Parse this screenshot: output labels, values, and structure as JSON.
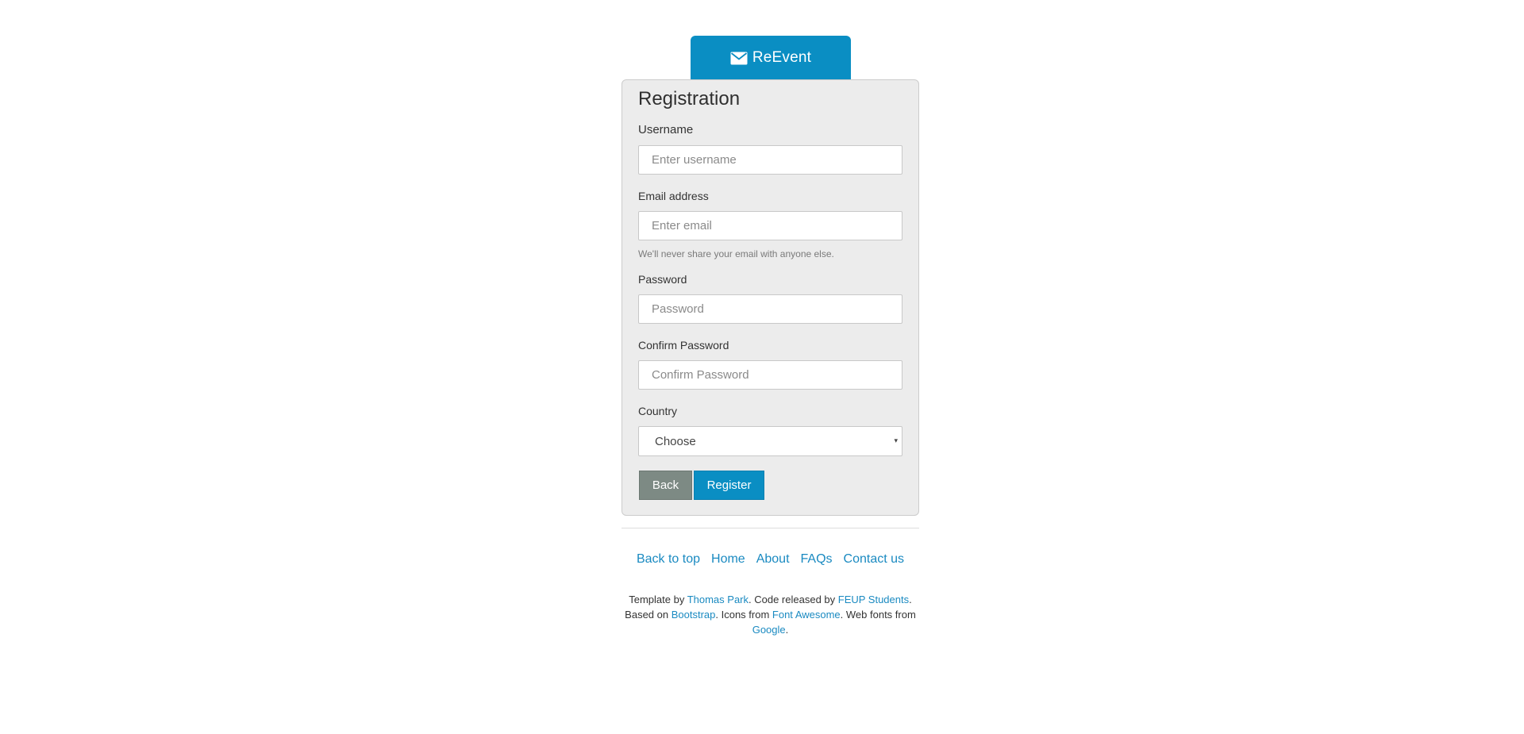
{
  "brand": {
    "name": "ReEvent",
    "icon": "envelope-icon",
    "color": "#0a8ec3"
  },
  "form": {
    "title": "Registration",
    "username": {
      "label": "Username",
      "placeholder": "Enter username"
    },
    "email": {
      "label": "Email address",
      "placeholder": "Enter email",
      "helper": "We'll never share your email with anyone else."
    },
    "password": {
      "label": "Password",
      "placeholder": "Password"
    },
    "confirm_password": {
      "label": "Confirm Password",
      "placeholder": "Confirm Password"
    },
    "country": {
      "label": "Country",
      "selected": "Choose",
      "caret": "▾"
    },
    "buttons": {
      "back": "Back",
      "register": "Register"
    }
  },
  "footer": {
    "nav": {
      "back_to_top": "Back to top",
      "home": "Home",
      "about": "About",
      "faqs": "FAQs",
      "contact": "Contact us"
    },
    "credits": {
      "template_by": "Template by ",
      "thomas_park": "Thomas Park",
      "code_released_by": ". Code released by ",
      "feup_students": "FEUP Students",
      "based_on": ". Based on ",
      "bootstrap": "Bootstrap",
      "icons_from": ". Icons from ",
      "font_awesome": "Font Awesome",
      "web_fonts_from": ". Web fonts from ",
      "google": "Google",
      "period": "."
    }
  }
}
